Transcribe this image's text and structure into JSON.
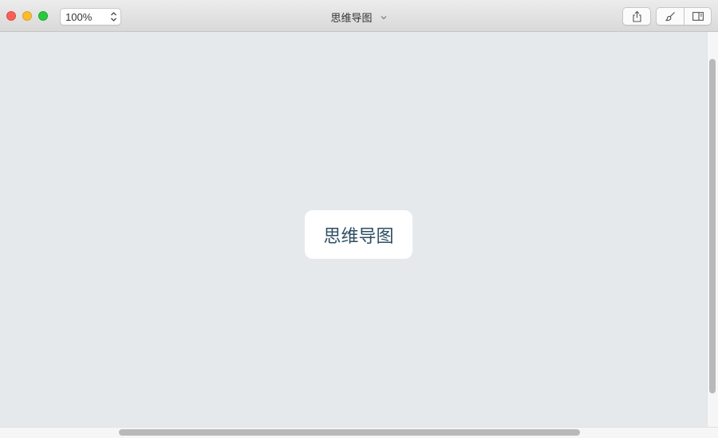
{
  "window": {
    "title": "思维导图",
    "controls": [
      "close-button",
      "minimize-button",
      "zoom-button"
    ]
  },
  "toolbar": {
    "zoom_value": "100%",
    "share_icon": "share-icon",
    "format_icon": "paintbrush-icon",
    "sidebar_icon": "sidebar-icon"
  },
  "canvas": {
    "central_topic": "思维导图"
  },
  "colors": {
    "canvas_background": "#e6e9ec",
    "topic_background": "#ffffff",
    "topic_text": "#2d4e62",
    "close": "#fc5f57",
    "minimize": "#fdbc2e",
    "zoom": "#28c840"
  }
}
